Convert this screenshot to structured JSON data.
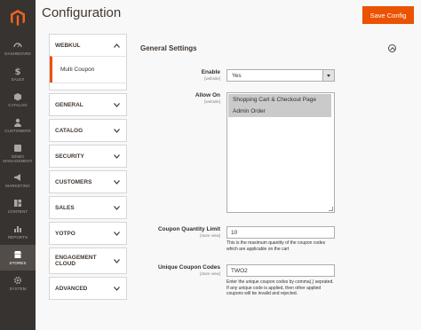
{
  "nav": {
    "logo_icon": "magento-logo-icon",
    "items": [
      {
        "label": "Dashboard",
        "icon": "dashboard-icon"
      },
      {
        "label": "Sales",
        "icon": "dollar-icon"
      },
      {
        "label": "Catalog",
        "icon": "box-icon"
      },
      {
        "label": "Customers",
        "icon": "person-icon"
      },
      {
        "label": "Demo Management",
        "icon": "demo-icon"
      },
      {
        "label": "Marketing",
        "icon": "megaphone-icon"
      },
      {
        "label": "Content",
        "icon": "layout-icon"
      },
      {
        "label": "Reports",
        "icon": "bar-chart-icon"
      },
      {
        "label": "Stores",
        "icon": "store-icon",
        "active": true
      },
      {
        "label": "System",
        "icon": "gear-icon"
      }
    ]
  },
  "header": {
    "title": "Configuration",
    "save_label": "Save Config",
    "accent": "#eb5202"
  },
  "tabs": {
    "webkul": {
      "label": "WEBKUL",
      "sub": "Multi Coupon"
    },
    "others": [
      "GENERAL",
      "CATALOG",
      "SECURITY",
      "CUSTOMERS",
      "SALES",
      "YOTPO",
      "ENGAGEMENT CLOUD",
      "ADVANCED"
    ]
  },
  "section": {
    "title": "General Settings",
    "enable": {
      "label": "Enable",
      "scope": "[website]",
      "value": "Yes"
    },
    "allow_on": {
      "label": "Allow On",
      "scope": "[website]",
      "options": [
        "Shopping Cart & Checkout Page",
        "Admin Order"
      ]
    },
    "quantity": {
      "label": "Coupon Quantity Limit",
      "scope": "[store view]",
      "value": "10",
      "note": "This is the maximum quantity of the coupon codes which are applicable on the cart"
    },
    "codes": {
      "label": "Unique Coupon Codes",
      "scope": "[store view]",
      "value": "TWO2",
      "note": "Enter the unique coupon codes by comma(,) seprated. If any unique code is applied, then other applied coupons will be invalid and rejected."
    }
  }
}
